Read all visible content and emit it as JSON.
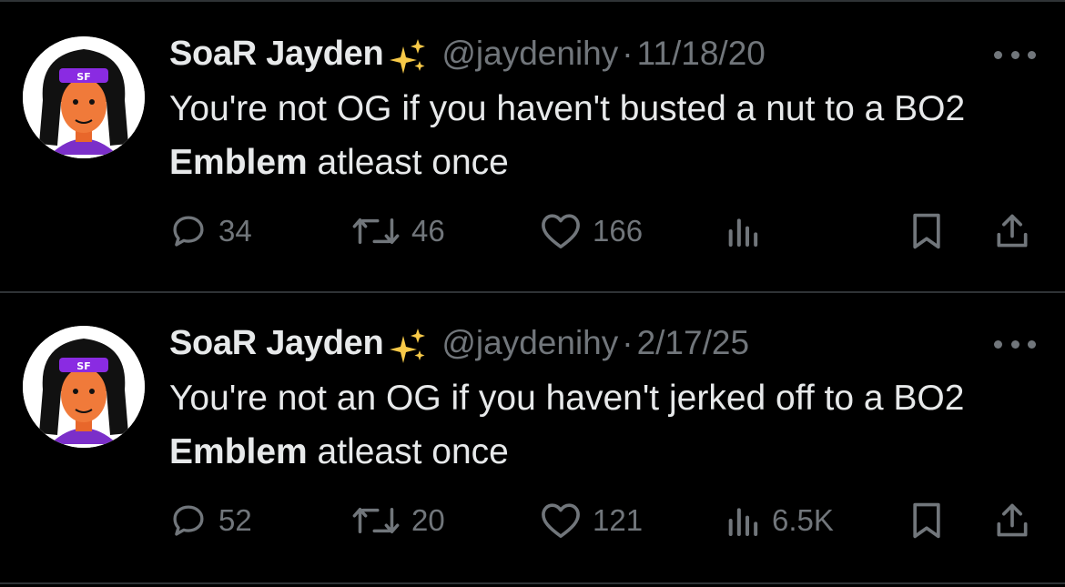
{
  "tweets": [
    {
      "author_name": "SoaR Jayden",
      "author_emoji": "✨",
      "handle": "@jaydenihy",
      "separator": "·",
      "date": "11/18/20",
      "text_before": "You're not OG if you haven't busted a nut to a BO2 ",
      "text_bold": "Emblem",
      "text_after": " atleast once",
      "replies": "34",
      "reposts": "46",
      "likes": "166",
      "views": ""
    },
    {
      "author_name": "SoaR Jayden",
      "author_emoji": "✨",
      "handle": "@jaydenihy",
      "separator": "·",
      "date": "2/17/25",
      "text_before": "You're not an OG if you haven't jerked off to a BO2 ",
      "text_bold": "Emblem",
      "text_after": " atleast once",
      "replies": "52",
      "reposts": "20",
      "likes": "121",
      "views": "6.5K"
    }
  ],
  "colors": {
    "background": "#000000",
    "text": "#e7e9ea",
    "muted": "#71767b",
    "divider": "#2f3336",
    "avatar_accent": "#8a2be2"
  },
  "icons": [
    "reply-icon",
    "repost-icon",
    "like-icon",
    "views-icon",
    "bookmark-icon",
    "share-icon",
    "more-icon",
    "sparkles-emoji"
  ]
}
